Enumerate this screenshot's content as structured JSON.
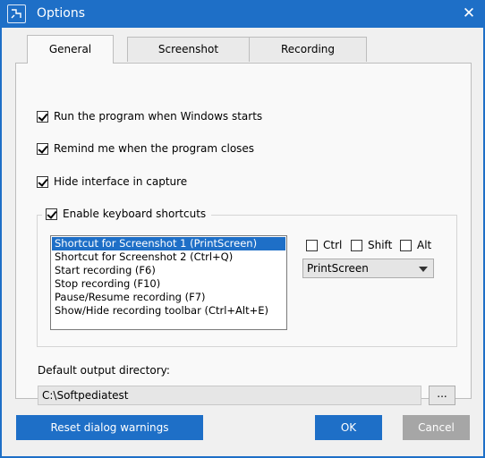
{
  "window": {
    "title": "Options",
    "close_symbol": "✕"
  },
  "tabs": [
    {
      "label": "General",
      "active": true
    },
    {
      "label": "Screenshot",
      "active": false
    },
    {
      "label": "Recording",
      "active": false
    }
  ],
  "general": {
    "options": [
      {
        "label": "Run the program when Windows starts",
        "checked": true
      },
      {
        "label": "Remind me when the program closes",
        "checked": true
      },
      {
        "label": "Hide interface in capture",
        "checked": true
      }
    ],
    "shortcuts_group": {
      "label": "Enable keyboard shortcuts",
      "checked": true,
      "items": [
        "Shortcut for Screenshot 1 (PrintScreen)",
        "Shortcut for Screenshot 2 (Ctrl+Q)",
        "Start recording (F6)",
        "Stop recording (F10)",
        "Pause/Resume recording (F7)",
        "Show/Hide recording toolbar (Ctrl+Alt+E)"
      ],
      "selected_index": 0,
      "modifiers": [
        {
          "label": "Ctrl",
          "checked": false
        },
        {
          "label": "Shift",
          "checked": false
        },
        {
          "label": "Alt",
          "checked": false
        }
      ],
      "key_value": "PrintScreen"
    },
    "output_dir_label": "Default output directory:",
    "output_dir_value": "C:\\Softpediatest",
    "browse_label": "..."
  },
  "buttons": {
    "reset": "Reset dialog warnings",
    "ok": "OK",
    "cancel": "Cancel"
  },
  "colors": {
    "accent": "#1e6fc7",
    "disabled_button": "#a6a6a6"
  },
  "icons": [
    "app-icon",
    "close-icon",
    "dropdown-arrow-icon"
  ]
}
